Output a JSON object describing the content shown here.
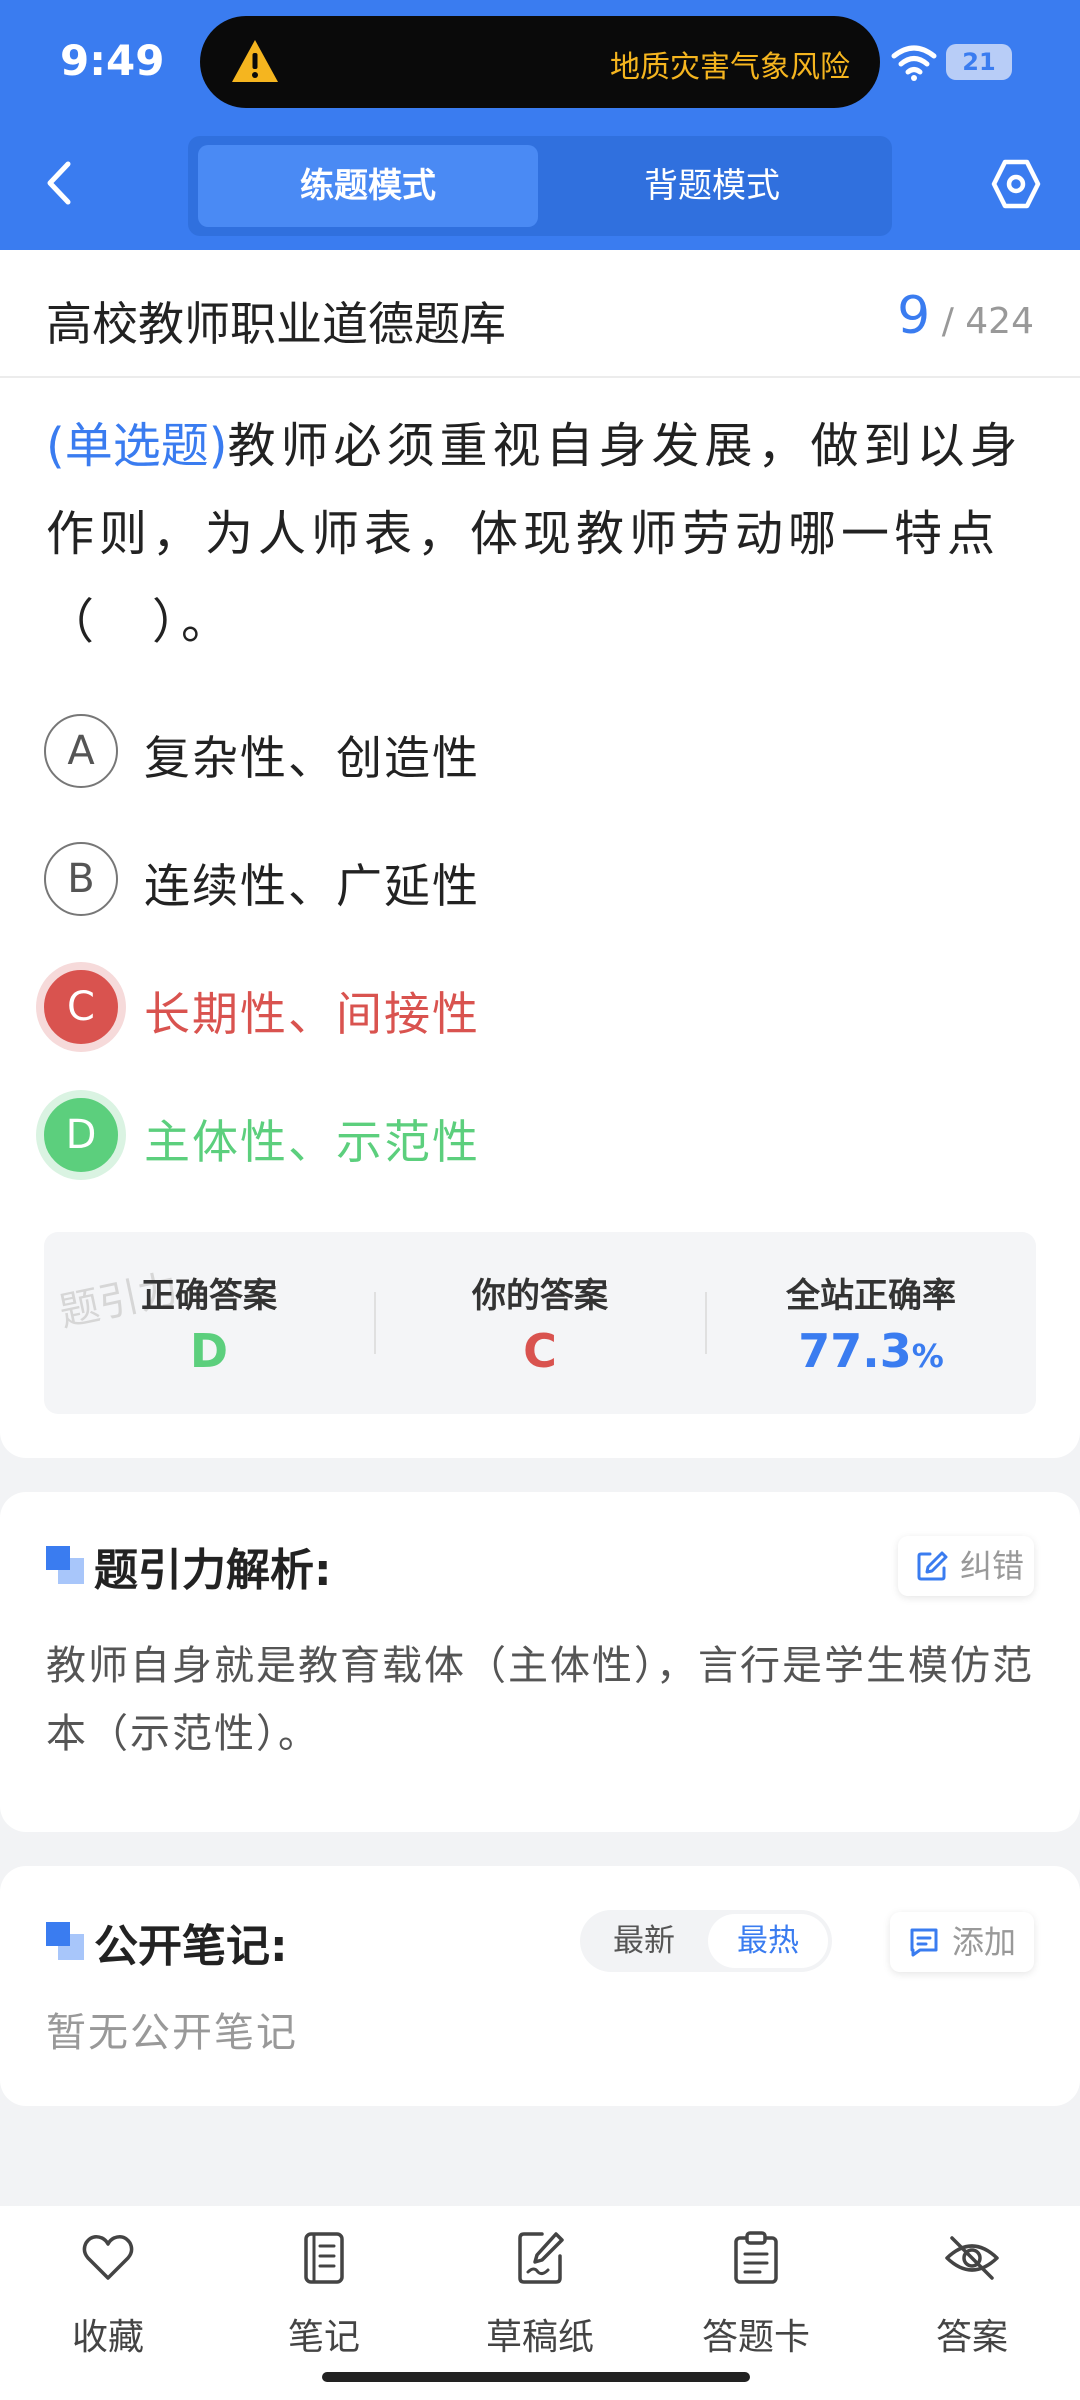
{
  "status": {
    "time": "9:49",
    "alert_text": "地质灾害气象风险",
    "battery": "21"
  },
  "header": {
    "modes": [
      "练题模式",
      "背题模式"
    ],
    "active_mode": "练题模式"
  },
  "question_bank": {
    "title": "高校教师职业道德题库",
    "current": "9",
    "separator": "/",
    "total": "424"
  },
  "question": {
    "type": "(单选题)",
    "text": "教师必须重视自身发展，做到以身作则，为人师表，体现教师劳动哪一特点（　）。",
    "options": [
      {
        "letter": "A",
        "text": "复杂性、创造性",
        "state": "normal"
      },
      {
        "letter": "B",
        "text": "连续性、广延性",
        "state": "normal"
      },
      {
        "letter": "C",
        "text": "长期性、间接性",
        "state": "wrong"
      },
      {
        "letter": "D",
        "text": "主体性、示范性",
        "state": "correct"
      }
    ]
  },
  "result": {
    "watermark": "题引力",
    "correct_label": "正确答案",
    "correct_value": "D",
    "yours_label": "你的答案",
    "yours_value": "C",
    "rate_label": "全站正确率",
    "rate_value": "77.3",
    "rate_unit": "%",
    "colors": {
      "correct": "#5ccf7d",
      "wrong": "#d9534f",
      "accent": "#3a7cf0"
    }
  },
  "analysis": {
    "title": "题引力解析:",
    "report_label": "纠错",
    "text": "教师自身就是教育载体（主体性），言行是学生模仿范本（示范性）。"
  },
  "notes": {
    "title": "公开笔记:",
    "sort_options": [
      "最新",
      "最热"
    ],
    "active_sort": "最热",
    "add_label": "添加",
    "empty_text": "暂无公开笔记"
  },
  "bottom_nav": [
    {
      "label": "收藏",
      "icon": "heart-icon"
    },
    {
      "label": "笔记",
      "icon": "notebook-icon"
    },
    {
      "label": "草稿纸",
      "icon": "draft-icon"
    },
    {
      "label": "答题卡",
      "icon": "answer-sheet-icon"
    },
    {
      "label": "答案",
      "icon": "eye-off-icon"
    }
  ]
}
